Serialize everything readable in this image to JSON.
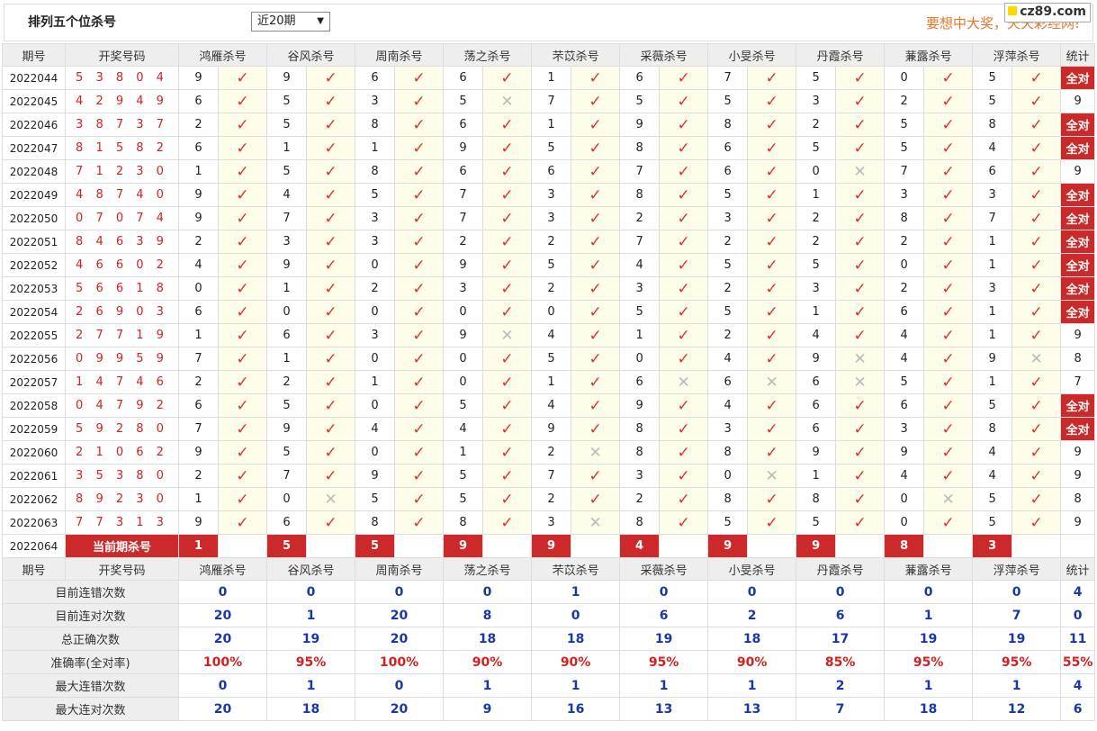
{
  "header": {
    "title": "排列五个位杀号",
    "select_value": "近20期",
    "slogan": "要想中大奖，天天彩经网!",
    "logo": "cz89.com"
  },
  "columns": {
    "period": "期号",
    "numbers": "开奖号码",
    "experts": [
      "鸿雁杀号",
      "谷风杀号",
      "周南杀号",
      "荡之杀号",
      "芣苡杀号",
      "采薇杀号",
      "小旻杀号",
      "丹霞杀号",
      "蒹露杀号",
      "浮萍杀号"
    ],
    "total": "统计"
  },
  "rows": [
    {
      "period": "2022044",
      "numbers": "5 3 8 0 4",
      "kills": [
        "9",
        "9",
        "6",
        "6",
        "1",
        "6",
        "7",
        "5",
        "0",
        "5"
      ],
      "results": [
        1,
        1,
        1,
        1,
        1,
        1,
        1,
        1,
        1,
        1
      ],
      "total": "全对"
    },
    {
      "period": "2022045",
      "numbers": "4 2 9 4 9",
      "kills": [
        "6",
        "5",
        "3",
        "5",
        "7",
        "5",
        "5",
        "3",
        "2",
        "5"
      ],
      "results": [
        1,
        1,
        1,
        0,
        1,
        1,
        1,
        1,
        1,
        1
      ],
      "total": "9"
    },
    {
      "period": "2022046",
      "numbers": "3 8 7 3 7",
      "kills": [
        "2",
        "5",
        "8",
        "6",
        "1",
        "9",
        "8",
        "2",
        "5",
        "8"
      ],
      "results": [
        1,
        1,
        1,
        1,
        1,
        1,
        1,
        1,
        1,
        1
      ],
      "total": "全对"
    },
    {
      "period": "2022047",
      "numbers": "8 1 5 8 2",
      "kills": [
        "6",
        "1",
        "1",
        "9",
        "5",
        "8",
        "6",
        "5",
        "5",
        "4"
      ],
      "results": [
        1,
        1,
        1,
        1,
        1,
        1,
        1,
        1,
        1,
        1
      ],
      "total": "全对"
    },
    {
      "period": "2022048",
      "numbers": "7 1 2 3 0",
      "kills": [
        "1",
        "5",
        "8",
        "6",
        "6",
        "7",
        "6",
        "0",
        "7",
        "6"
      ],
      "results": [
        1,
        1,
        1,
        1,
        1,
        1,
        1,
        0,
        1,
        1
      ],
      "total": "9"
    },
    {
      "period": "2022049",
      "numbers": "4 8 7 4 0",
      "kills": [
        "9",
        "4",
        "5",
        "7",
        "3",
        "8",
        "5",
        "1",
        "3",
        "3"
      ],
      "results": [
        1,
        1,
        1,
        1,
        1,
        1,
        1,
        1,
        1,
        1
      ],
      "total": "全对"
    },
    {
      "period": "2022050",
      "numbers": "0 7 0 7 4",
      "kills": [
        "9",
        "7",
        "3",
        "7",
        "3",
        "2",
        "3",
        "2",
        "8",
        "7"
      ],
      "results": [
        1,
        1,
        1,
        1,
        1,
        1,
        1,
        1,
        1,
        1
      ],
      "total": "全对"
    },
    {
      "period": "2022051",
      "numbers": "8 4 6 3 9",
      "kills": [
        "2",
        "3",
        "3",
        "2",
        "2",
        "7",
        "2",
        "2",
        "2",
        "1"
      ],
      "results": [
        1,
        1,
        1,
        1,
        1,
        1,
        1,
        1,
        1,
        1
      ],
      "total": "全对"
    },
    {
      "period": "2022052",
      "numbers": "4 6 6 0 2",
      "kills": [
        "4",
        "9",
        "0",
        "9",
        "5",
        "4",
        "5",
        "5",
        "0",
        "1"
      ],
      "results": [
        1,
        1,
        1,
        1,
        1,
        1,
        1,
        1,
        1,
        1
      ],
      "total": "全对"
    },
    {
      "period": "2022053",
      "numbers": "5 6 6 1 8",
      "kills": [
        "0",
        "1",
        "2",
        "3",
        "2",
        "3",
        "2",
        "3",
        "2",
        "3"
      ],
      "results": [
        1,
        1,
        1,
        1,
        1,
        1,
        1,
        1,
        1,
        1
      ],
      "total": "全对"
    },
    {
      "period": "2022054",
      "numbers": "2 6 9 0 3",
      "kills": [
        "6",
        "0",
        "0",
        "0",
        "0",
        "5",
        "5",
        "1",
        "6",
        "1"
      ],
      "results": [
        1,
        1,
        1,
        1,
        1,
        1,
        1,
        1,
        1,
        1
      ],
      "total": "全对"
    },
    {
      "period": "2022055",
      "numbers": "2 7 7 1 9",
      "kills": [
        "1",
        "6",
        "3",
        "9",
        "4",
        "1",
        "2",
        "4",
        "4",
        "1"
      ],
      "results": [
        1,
        1,
        1,
        0,
        1,
        1,
        1,
        1,
        1,
        1
      ],
      "total": "9"
    },
    {
      "period": "2022056",
      "numbers": "0 9 9 5 9",
      "kills": [
        "7",
        "1",
        "0",
        "0",
        "5",
        "0",
        "4",
        "9",
        "4",
        "9"
      ],
      "results": [
        1,
        1,
        1,
        1,
        1,
        1,
        1,
        0,
        1,
        0
      ],
      "total": "8"
    },
    {
      "period": "2022057",
      "numbers": "1 4 7 4 6",
      "kills": [
        "2",
        "2",
        "1",
        "0",
        "1",
        "6",
        "6",
        "6",
        "5",
        "1"
      ],
      "results": [
        1,
        1,
        1,
        1,
        1,
        0,
        0,
        0,
        1,
        1
      ],
      "total": "7"
    },
    {
      "period": "2022058",
      "numbers": "0 4 7 9 2",
      "kills": [
        "6",
        "5",
        "0",
        "5",
        "4",
        "9",
        "4",
        "6",
        "6",
        "5"
      ],
      "results": [
        1,
        1,
        1,
        1,
        1,
        1,
        1,
        1,
        1,
        1
      ],
      "total": "全对"
    },
    {
      "period": "2022059",
      "numbers": "5 9 2 8 0",
      "kills": [
        "7",
        "9",
        "4",
        "4",
        "9",
        "8",
        "3",
        "6",
        "3",
        "8"
      ],
      "results": [
        1,
        1,
        1,
        1,
        1,
        1,
        1,
        1,
        1,
        1
      ],
      "total": "全对"
    },
    {
      "period": "2022060",
      "numbers": "2 1 0 6 2",
      "kills": [
        "9",
        "5",
        "0",
        "1",
        "2",
        "8",
        "8",
        "9",
        "9",
        "4"
      ],
      "results": [
        1,
        1,
        1,
        1,
        0,
        1,
        1,
        1,
        1,
        1
      ],
      "total": "9"
    },
    {
      "period": "2022061",
      "numbers": "3 5 3 8 0",
      "kills": [
        "2",
        "7",
        "9",
        "5",
        "7",
        "3",
        "0",
        "1",
        "4",
        "4"
      ],
      "results": [
        1,
        1,
        1,
        1,
        1,
        1,
        0,
        1,
        1,
        1
      ],
      "total": "9"
    },
    {
      "period": "2022062",
      "numbers": "8 9 2 3 0",
      "kills": [
        "1",
        "0",
        "5",
        "5",
        "2",
        "2",
        "8",
        "8",
        "0",
        "5"
      ],
      "results": [
        1,
        0,
        1,
        1,
        1,
        1,
        1,
        1,
        0,
        1
      ],
      "total": "8"
    },
    {
      "period": "2022063",
      "numbers": "7 7 3 1 3",
      "kills": [
        "9",
        "6",
        "8",
        "8",
        "3",
        "8",
        "5",
        "5",
        "0",
        "5"
      ],
      "results": [
        1,
        1,
        1,
        1,
        0,
        1,
        1,
        1,
        1,
        1
      ],
      "total": "9"
    }
  ],
  "current": {
    "period": "2022064",
    "label": "当前期杀号",
    "kills": [
      "1",
      "5",
      "5",
      "9",
      "9",
      "4",
      "9",
      "9",
      "8",
      "3"
    ]
  },
  "stats": [
    {
      "label": "目前连错次数",
      "values": [
        "0",
        "0",
        "0",
        "0",
        "1",
        "0",
        "0",
        "0",
        "0",
        "0"
      ],
      "total": "4"
    },
    {
      "label": "目前连对次数",
      "values": [
        "20",
        "1",
        "20",
        "8",
        "0",
        "6",
        "2",
        "6",
        "1",
        "7"
      ],
      "total": "0"
    },
    {
      "label": "总正确次数",
      "values": [
        "20",
        "19",
        "20",
        "18",
        "18",
        "19",
        "18",
        "17",
        "19",
        "19"
      ],
      "total": "11"
    },
    {
      "label": "准确率(全对率)",
      "values": [
        "100%",
        "95%",
        "100%",
        "90%",
        "90%",
        "95%",
        "90%",
        "85%",
        "95%",
        "95%"
      ],
      "total": "55%"
    },
    {
      "label": "最大连错次数",
      "values": [
        "0",
        "1",
        "0",
        "1",
        "1",
        "1",
        "1",
        "2",
        "1",
        "1"
      ],
      "total": "4"
    },
    {
      "label": "最大连对次数",
      "values": [
        "20",
        "18",
        "20",
        "9",
        "16",
        "13",
        "13",
        "7",
        "18",
        "12"
      ],
      "total": "6"
    }
  ],
  "icons": {
    "correct": "check-mark-icon",
    "wrong": "cross-mark-icon"
  },
  "colors": {
    "accent": "#cc2a2a",
    "numbers": "#d42020",
    "stats": "#1a37a8",
    "slogan": "#e8742b"
  }
}
